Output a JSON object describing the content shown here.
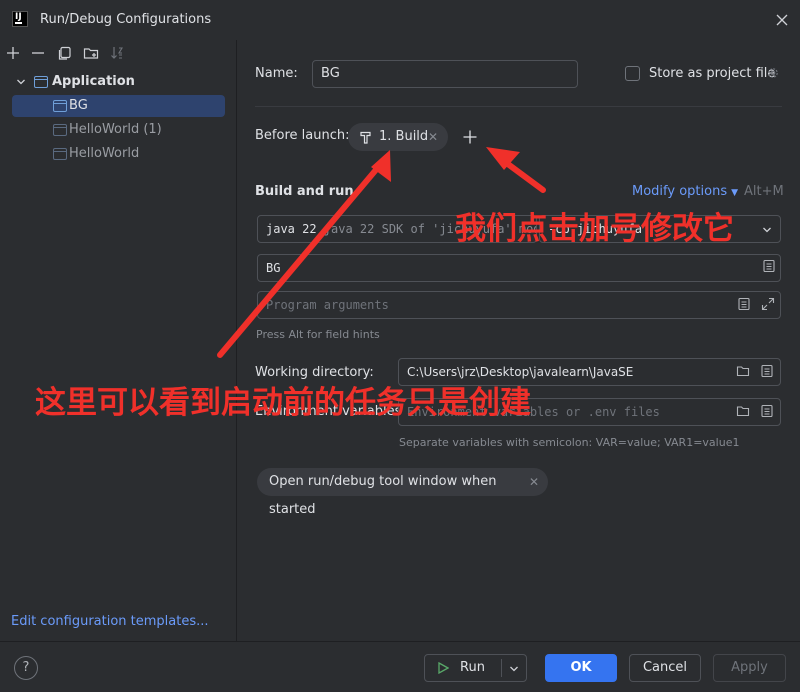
{
  "window": {
    "title": "Run/Debug Configurations",
    "logo_text": "IJ"
  },
  "tree": {
    "group": "Application",
    "items": [
      {
        "label": "BG"
      },
      {
        "label": "HelloWorld (1)"
      },
      {
        "label": "HelloWorld"
      }
    ]
  },
  "left": {
    "edit_templates": "Edit configuration templates..."
  },
  "form": {
    "name_label": "Name:",
    "name_value": "BG",
    "store_label": "Store as project file",
    "before_launch_label": "Before launch:",
    "build_chip": "1. Build",
    "section_title": "Build and run",
    "modify_options": "Modify options",
    "modify_shortcut": "Alt+M",
    "jdk_value": "java 22 SDK of 'jichuyufa' module",
    "module_value": "-cp jichuyufa",
    "main_class": "BG",
    "program_args_placeholder": "Program arguments",
    "field_hint": "Press Alt for field hints",
    "working_dir_label": "Working directory:",
    "working_dir_value": "C:\\Users\\jrz\\Desktop\\javalearn\\JavaSE",
    "env_label": "Environment variables:",
    "env_placeholder": "Environment variables or .env files",
    "env_hint": "Separate variables with semicolon: VAR=value; VAR1=value1",
    "open_tool_chip": "Open run/debug tool window when started"
  },
  "buttons": {
    "run": "Run",
    "ok": "OK",
    "cancel": "Cancel",
    "apply": "Apply",
    "help": "?"
  },
  "annotations": {
    "plus_note": "我们点击加号修改它",
    "before_note": "这里可以看到启动前的任务只是创建"
  },
  "colors": {
    "accent": "#3574f0",
    "annotation": "#f0302a",
    "link": "#6b9bfa"
  }
}
